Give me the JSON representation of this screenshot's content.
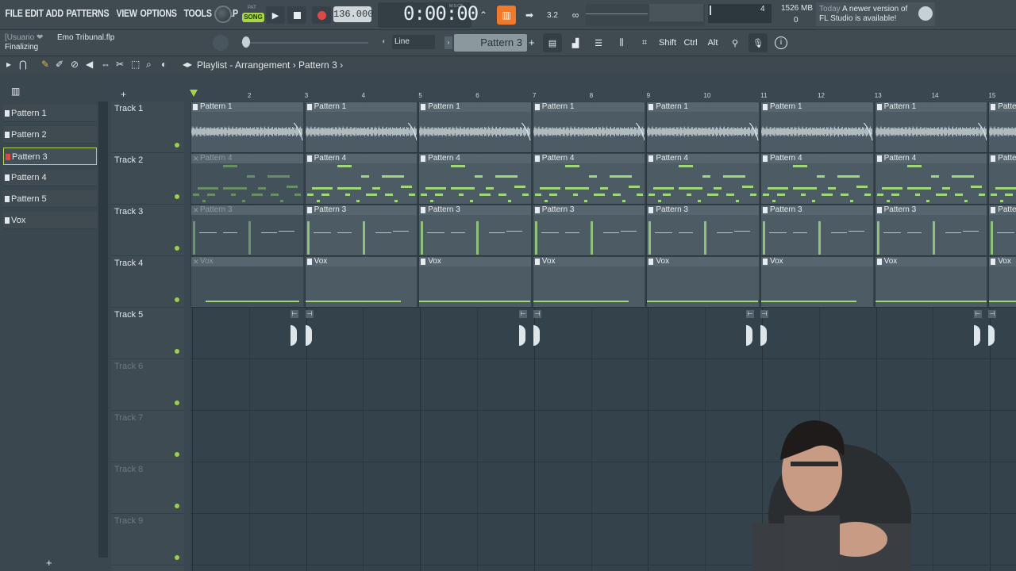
{
  "menu": [
    "FILE",
    "EDIT",
    "ADD",
    "PATTERNS",
    "VIEW",
    "OPTIONS",
    "TOOLS",
    "HELP"
  ],
  "transport": {
    "pat_label": "PAT",
    "song_label": "SONG",
    "tempo": "136.000",
    "time": "0:00:00",
    "time_unit": "M:S:CS"
  },
  "monitor": {
    "cpu_value": "4",
    "memory": "1526 MB",
    "polyphony": "0"
  },
  "news": {
    "today": "Today",
    "line1": "A newer version of",
    "line2": "FL Studio is available!"
  },
  "project": {
    "user": "[Usuario ❤",
    "name": "Emo Tribunal.flp",
    "hint": "Finalizing"
  },
  "snap": {
    "value": "Line"
  },
  "pattern_selector": {
    "value": "Pattern 3"
  },
  "keys": {
    "shift": "Shift",
    "ctrl": "Ctrl",
    "alt": "Alt"
  },
  "playlist": {
    "title": "Playlist - Arrangement › Pattern 3 ›"
  },
  "picker": {
    "items": [
      "Pattern 1",
      "Pattern 2",
      "Pattern 3",
      "Pattern 4",
      "Pattern 5",
      "Vox"
    ],
    "selected": "Pattern 3",
    "add": "+"
  },
  "tracks": [
    "Track 1",
    "Track 2",
    "Track 3",
    "Track 4",
    "Track 5",
    "Track 6",
    "Track 7",
    "Track 8",
    "Track 9"
  ],
  "ruler": [
    "2",
    "3",
    "4",
    "5",
    "6",
    "7",
    "8",
    "9",
    "10",
    "11",
    "12",
    "13",
    "14",
    "15"
  ],
  "clips": {
    "track1": "Pattern 1",
    "track2": "Pattern 4",
    "track3": "Pattern 3",
    "track4": "Vox"
  },
  "colors": {
    "accent": "#a8d64a",
    "step_active": "#f07a2a",
    "note": "#9fd87a"
  }
}
